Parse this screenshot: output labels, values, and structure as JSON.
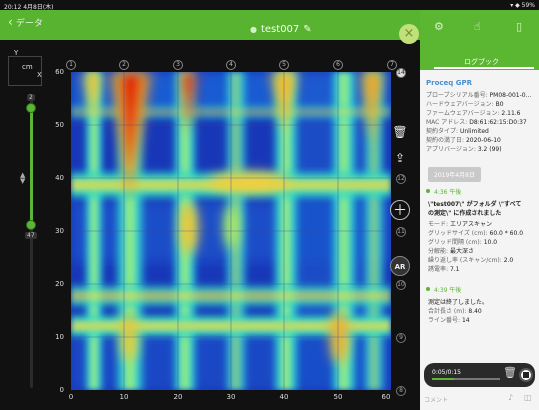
{
  "status_bar": {
    "time_date": "20:12 4月8日(木)",
    "signal": "▾ ◆ 59%"
  },
  "header": {
    "back_label": "データ",
    "title": "test007",
    "title_icon": "pencil-icon"
  },
  "units": {
    "y": "Y",
    "cm": "cm",
    "x": "X"
  },
  "depth": {
    "top": "2",
    "bottom": "47",
    "top_level": 0.04,
    "bottom_level": 0.94
  },
  "axes": {
    "y_ticks": [
      "60",
      "50",
      "40",
      "30",
      "20",
      "10",
      "0"
    ],
    "x_ticks": [
      "0",
      "10",
      "20",
      "30",
      "40",
      "50",
      "60"
    ]
  },
  "top_markers": [
    "1",
    "2",
    "3",
    "4",
    "5",
    "6",
    "7"
  ],
  "right_markers": [
    "14",
    "13",
    "12",
    "11",
    "10",
    "9",
    "8"
  ],
  "panel": {
    "tabs": [
      "gear-icon",
      "person-icon",
      "book-icon"
    ],
    "logbook_label": "ログブック",
    "device_name": "Proceq GPR",
    "props": [
      {
        "k": "プローブシリアル番号:",
        "v": "PM08-001-0..."
      },
      {
        "k": "ハードウェアバージョン:",
        "v": "B0"
      },
      {
        "k": "ファームウェアバージョン:",
        "v": "2.11.6"
      },
      {
        "k": "MAC アドレス:",
        "v": "D8:61:62:15:D0:37"
      },
      {
        "k": "契約タイプ:",
        "v": "Unlimited"
      },
      {
        "k": "契約の満了日:",
        "v": "2020-06-10"
      },
      {
        "k": "アプリバージョン:",
        "v": "3.2 (99)"
      }
    ],
    "date_chip": "2019年4月8日",
    "entry1": {
      "time": "4:36 午後",
      "line1": "\\\"test007\\\" がフォルダ \\\"すべて",
      "line2": "の測定\\\" に作成されました",
      "details": [
        {
          "k": "モード:",
          "v": "エリアスキャン"
        },
        {
          "k": "グリッドサイズ (cm):",
          "v": "60.0 * 60.0"
        },
        {
          "k": "グリッド間隔 (cm):",
          "v": "10.0"
        },
        {
          "k": "分解能:",
          "v": "最大深さ"
        },
        {
          "k": "繰り返し率 (スキャン/cm):",
          "v": "2.0"
        },
        {
          "k": "誘電率:",
          "v": "7.1"
        }
      ]
    },
    "entry2": {
      "time": "4:39 午後",
      "line1": "測定は終了しました。",
      "details": [
        {
          "k": "合計長さ (m):",
          "v": "8.40"
        },
        {
          "k": "ライン番号:",
          "v": "14"
        }
      ]
    },
    "player": {
      "elapsed": "0:05/0:15",
      "progress": 0.33
    },
    "comment_placeholder": "コメント"
  }
}
